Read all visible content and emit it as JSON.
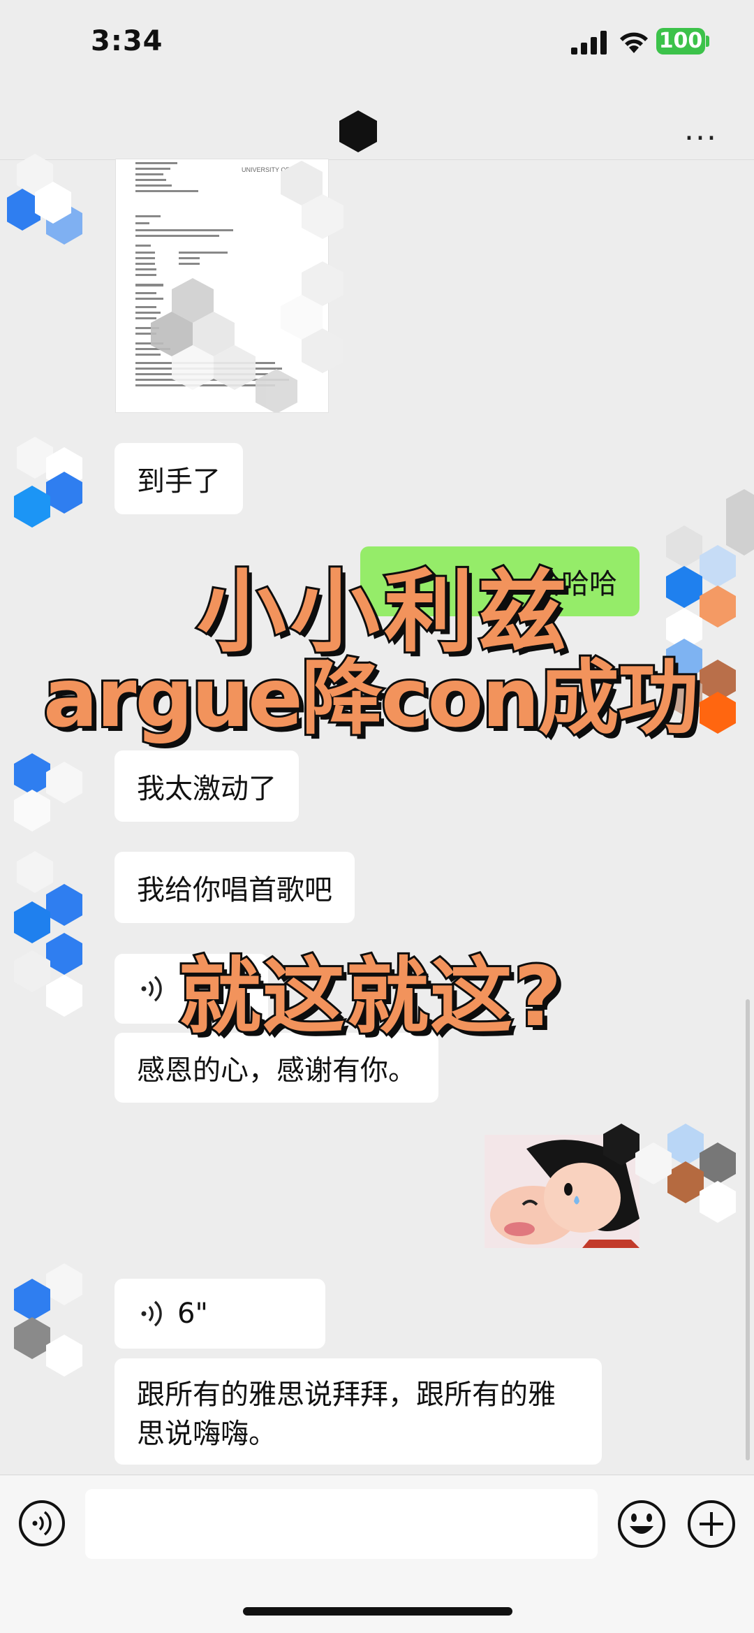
{
  "status_bar": {
    "time": "3:34",
    "battery": "100",
    "battery_color": "#3cc24a"
  },
  "header": {
    "more_label": "..."
  },
  "messages": [
    {
      "type": "image",
      "side": "left",
      "content": "document-scan",
      "doc": {
        "org": "UNIVERSITY OF LEEDS"
      }
    },
    {
      "type": "text",
      "side": "left",
      "text": "到手了"
    },
    {
      "type": "text",
      "side": "right",
      "text": "哈哈哈"
    },
    {
      "type": "text",
      "side": "left",
      "text": "我太激动了"
    },
    {
      "type": "text",
      "side": "left",
      "text": "我给你唱首歌吧"
    },
    {
      "type": "voice",
      "side": "left"
    },
    {
      "type": "text",
      "side": "left",
      "text": "感恩的心，感谢有你。"
    },
    {
      "type": "image",
      "side": "right",
      "content": "sticker"
    },
    {
      "type": "voice",
      "side": "left",
      "duration": "6\""
    },
    {
      "type": "text",
      "side": "left",
      "text": "跟所有的雅思说拜拜，跟所有的雅思说嗨嗨。"
    }
  ],
  "overlay": {
    "line1": "小小利兹",
    "line2": "argue降con成功",
    "line3": "就这就这?",
    "color": "#f2935c"
  },
  "input_bar": {
    "voice_icon": "voice-icon",
    "emoji_icon": "emoji-icon",
    "add_icon": "plus-icon"
  },
  "colors": {
    "chat_bg": "#ededed",
    "bubble_in": "#ffffff",
    "bubble_out": "#95ec69"
  }
}
